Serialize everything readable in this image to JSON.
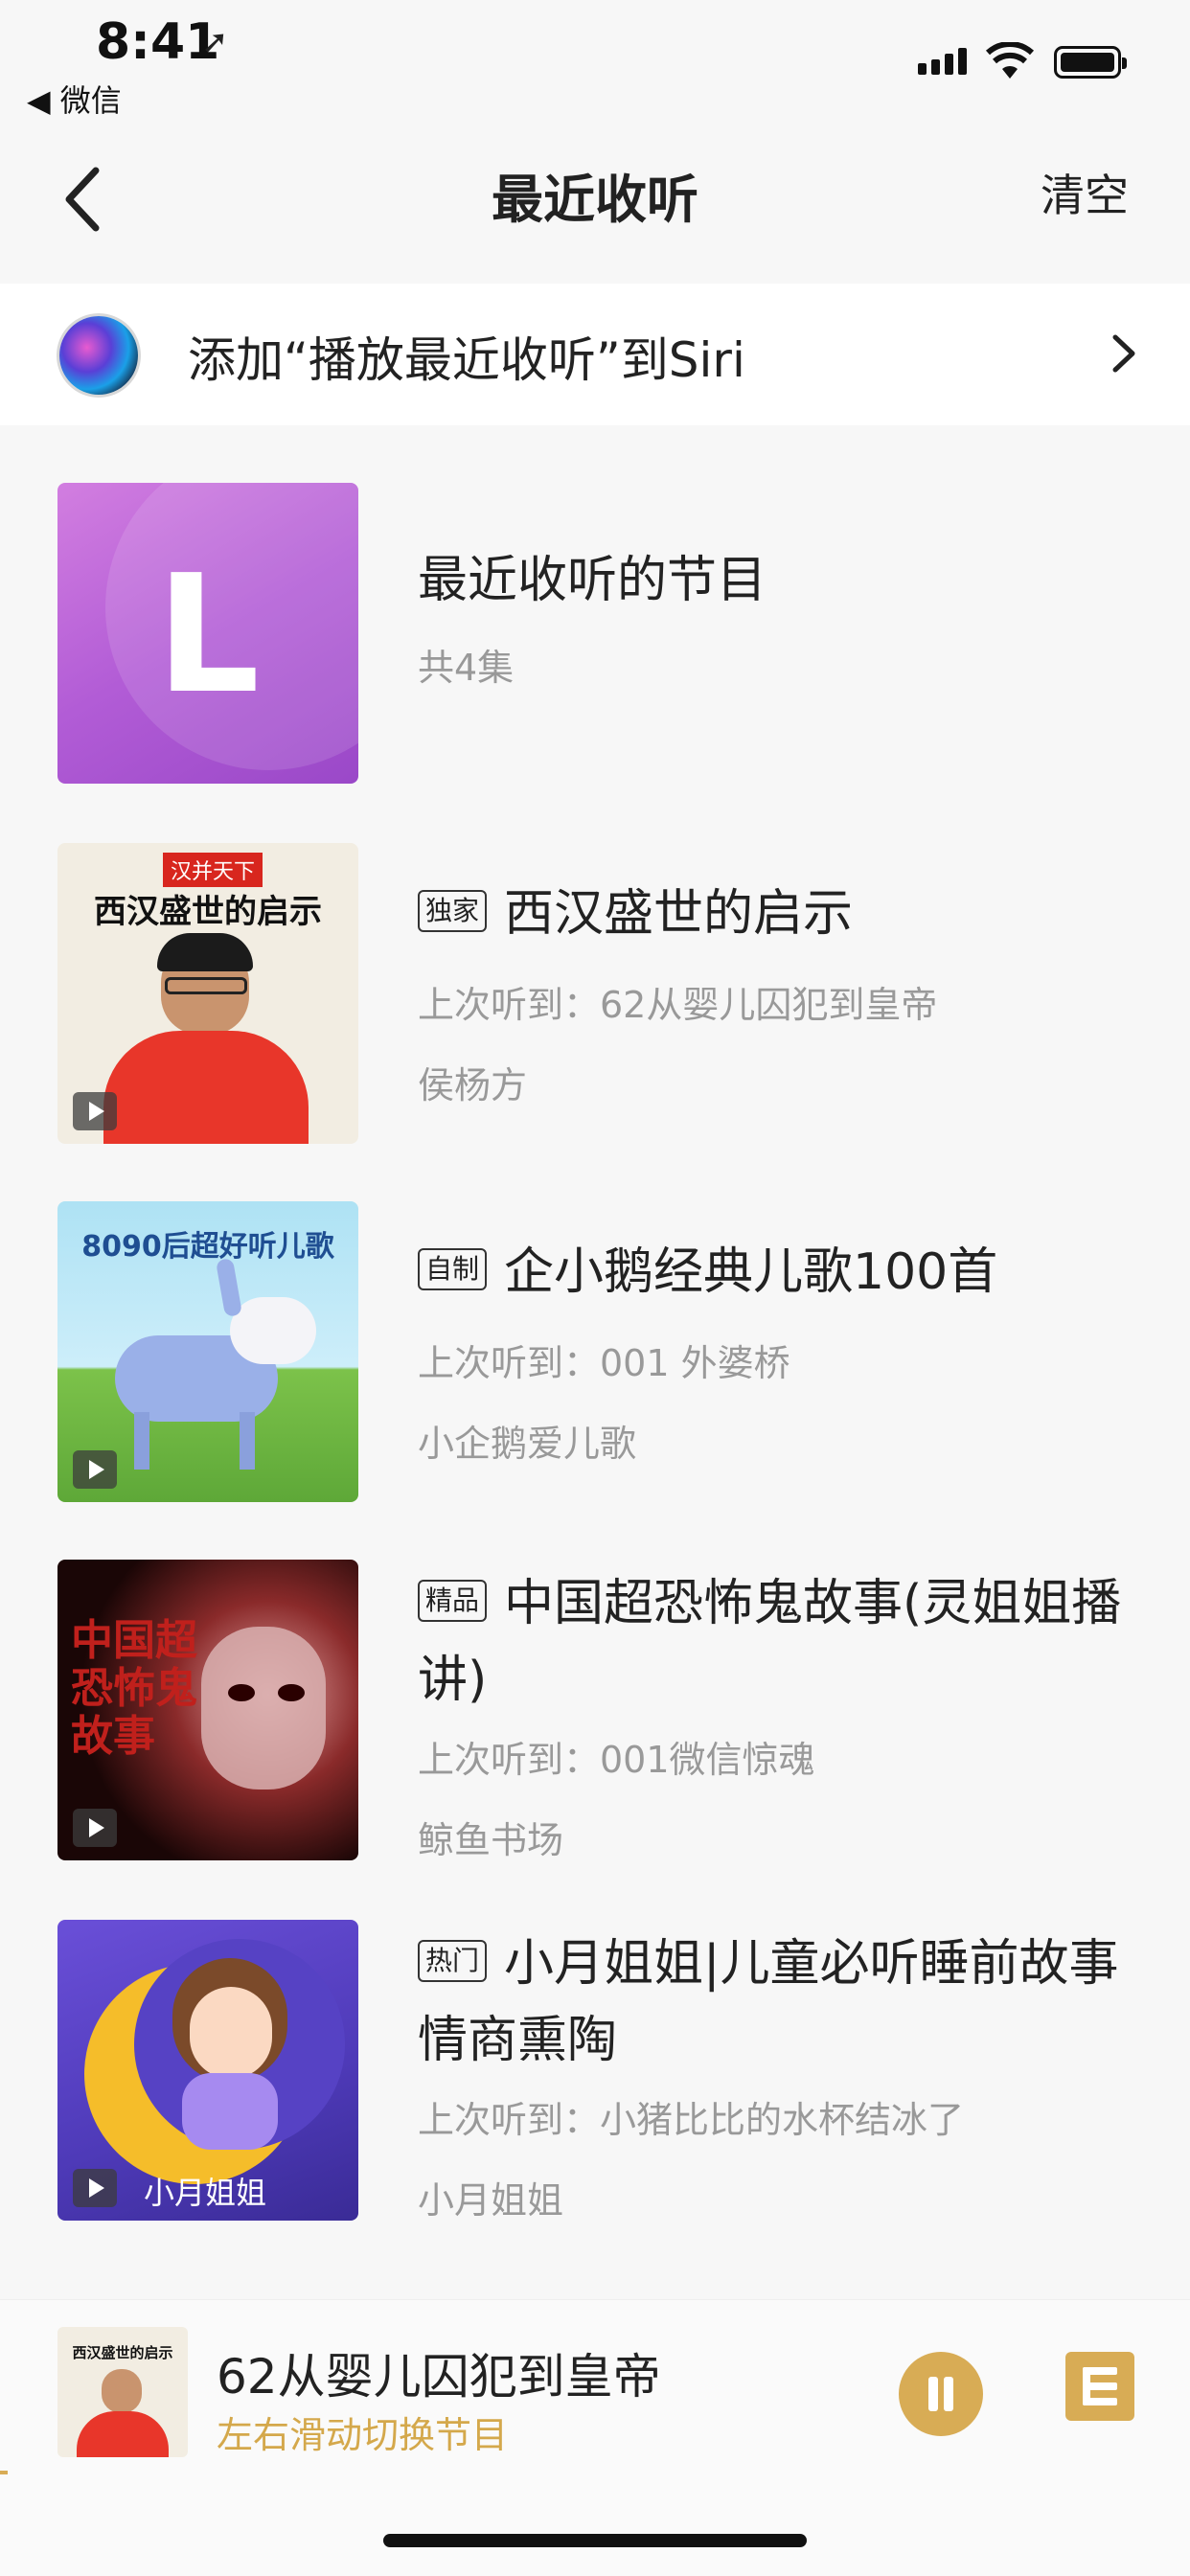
{
  "status_bar": {
    "time": "8:41",
    "back_app": "◀ 微信"
  },
  "nav": {
    "title": "最近收听",
    "clear_label": "清空"
  },
  "siri": {
    "text": "添加“播放最近收听”到Siri"
  },
  "recent_header": {
    "title": "最近收听的节目",
    "count": "共4集",
    "cover_letter": "L"
  },
  "items": [
    {
      "tag": "独家",
      "title": "西汉盛世的启示",
      "last_played": "上次听到：62从婴儿囚犯到皇帝",
      "author": "侯杨方",
      "cover_text": "西汉盛世的启示",
      "cover_top": "汉并天下"
    },
    {
      "tag": "自制",
      "title": "企小鹅经典儿歌100首",
      "last_played": "上次听到：001 外婆桥",
      "author": "小企鹅爱儿歌",
      "cover_text": "8090后超好听儿歌"
    },
    {
      "tag": "精品",
      "title": "中国超恐怖鬼故事(灵姐姐播讲)",
      "last_played": "上次听到：001微信惊魂",
      "author": "鲸鱼书场",
      "cover_text": "中国超恐怖鬼故事"
    },
    {
      "tag": "热门",
      "title": "小月姐姐|儿童必听睡前故事情商熏陶",
      "last_played": "上次听到：小猪比比的水杯结冰了",
      "author": "小月姐姐",
      "cover_text": "小月姐姐"
    }
  ],
  "player": {
    "title": "62从婴儿囚犯到皇帝",
    "hint": "左右滑动切换节目"
  },
  "colors": {
    "accent": "#d8ac55",
    "hint": "#d4a84b",
    "background": "#f7f7f7"
  }
}
